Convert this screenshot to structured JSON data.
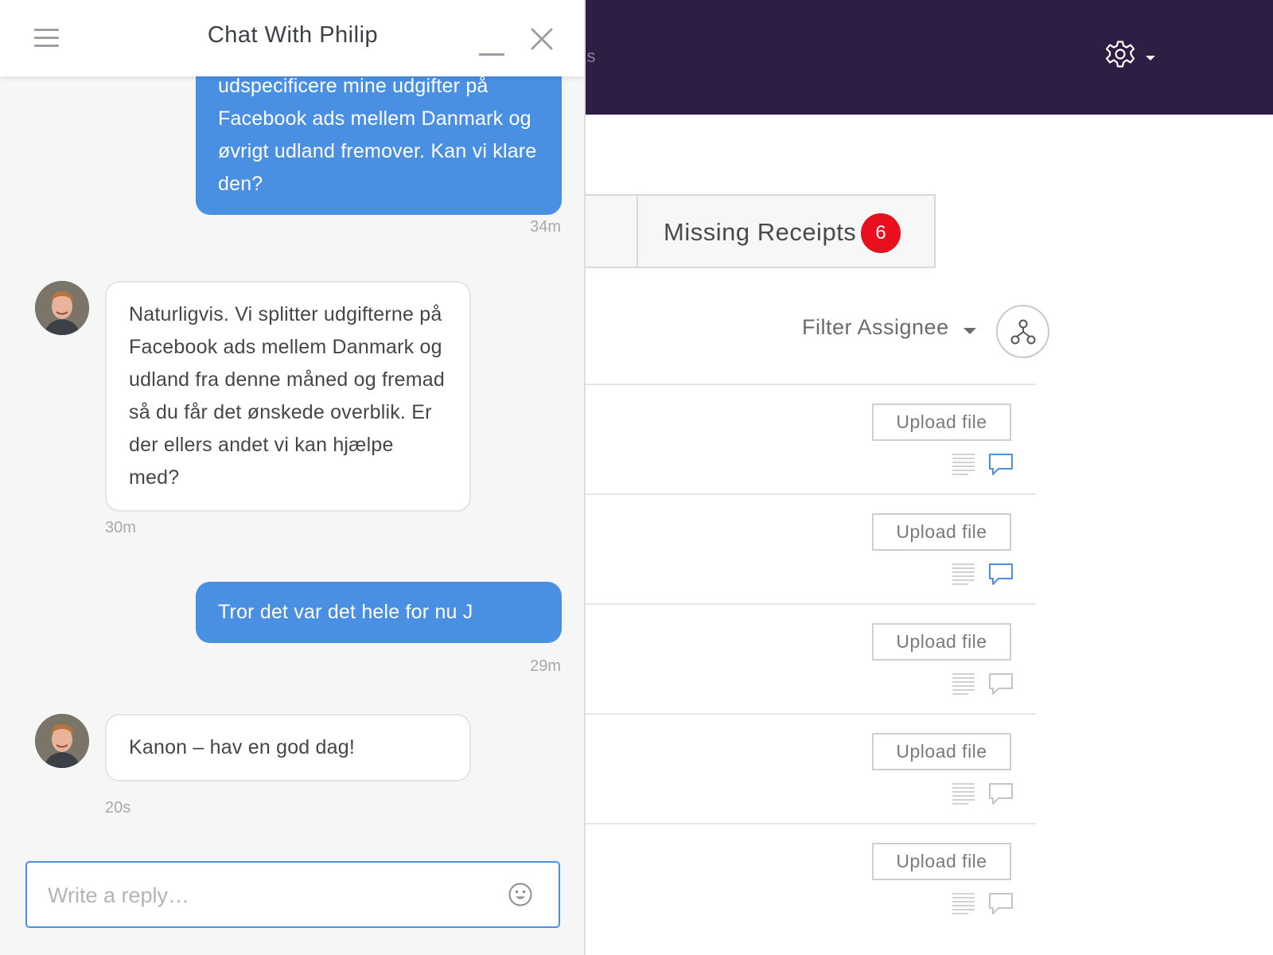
{
  "app": {
    "nav_partial_text": "rts",
    "tabs": [
      {
        "label": ""
      },
      {
        "label": "Missing Receipts",
        "badge": "6",
        "badge_color": "#e8101f"
      }
    ],
    "filter": {
      "label": "Filter Assignee"
    },
    "rows": [
      {
        "upload_label": "Upload file",
        "comment_active": true
      },
      {
        "upload_label": "Upload file",
        "comment_active": true
      },
      {
        "upload_label": "Upload file",
        "comment_active": false
      },
      {
        "upload_label": "Upload file",
        "comment_active": false
      },
      {
        "upload_label": "Upload file",
        "comment_active": false
      }
    ],
    "colors": {
      "topbar": "#2e1e44",
      "accent": "#4a90e2",
      "badge": "#e8101f"
    }
  },
  "chat": {
    "title": "Chat With Philip",
    "messages": [
      {
        "direction": "out",
        "text": "udspecificere mine udgifter på Facebook ads mellem Danmark og øvrigt udland fremover. Kan vi klare den?",
        "time": "34m"
      },
      {
        "direction": "in",
        "text": "Naturligvis. Vi splitter udgifterne på Facebook ads mellem Danmark og udland fra denne måned og fremad så du får det ønskede overblik. Er der ellers andet vi kan hjælpe med?",
        "time": "30m"
      },
      {
        "direction": "out",
        "text": "Tror det var det hele for nu J",
        "time": "29m"
      },
      {
        "direction": "in",
        "text": "Kanon – hav en god dag!",
        "time": "20s"
      }
    ],
    "reply": {
      "placeholder": "Write a reply…",
      "value": ""
    },
    "icons": [
      "menu-icon",
      "minimize-icon",
      "close-icon",
      "emoji-icon",
      "avatar"
    ]
  }
}
